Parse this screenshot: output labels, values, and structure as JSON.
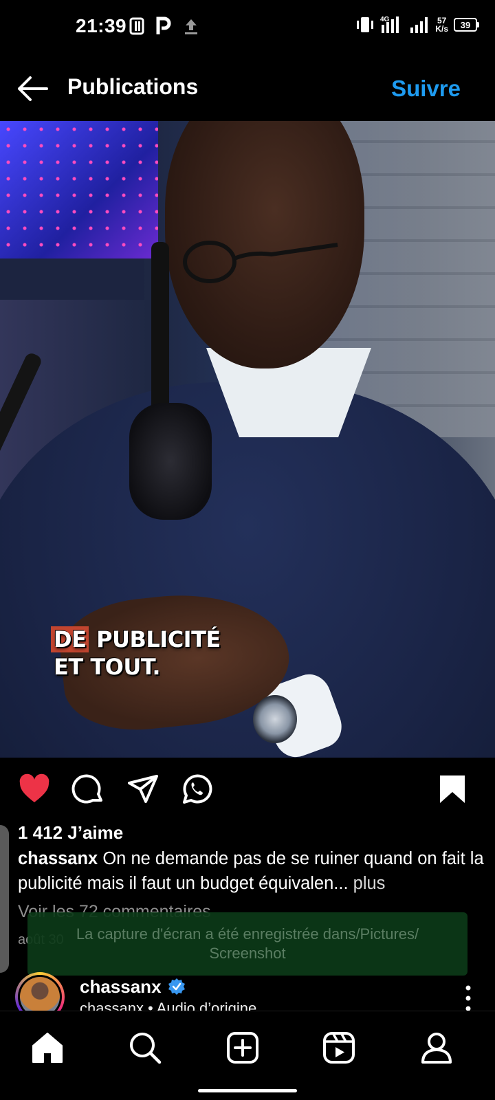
{
  "status_bar": {
    "time": "21:39",
    "net_speed_value": "57",
    "net_speed_unit": "K/s",
    "battery_level": "39",
    "network_type": "4G",
    "icons": [
      "screenshot-icon",
      "parking-app-icon",
      "upload-icon",
      "vibrate-icon",
      "signal-icon",
      "battery-icon"
    ]
  },
  "header": {
    "title": "Publications",
    "follow_label": "Suivre"
  },
  "media": {
    "caption_line1": "DE PUBLICITÉ",
    "caption_line2": "ET TOUT.",
    "caption_highlight": "DE",
    "muted": true
  },
  "actions": {
    "liked": true,
    "saved": true,
    "icons": [
      "heart-icon",
      "comment-icon",
      "share-icon",
      "whatsapp-icon",
      "bookmark-icon"
    ]
  },
  "post": {
    "likes": "1 412 J’aime",
    "author": "chassanx",
    "caption": "On ne demande pas de se ruiner quand on fait la publicité mais il faut un budget équivalen...",
    "more_label": "plus",
    "comments_link": "Voir les 72 commentaires",
    "date": "août 30"
  },
  "toast": {
    "line1": "La capture d'écran a été enregistrée dans/Pictures/",
    "line2": "Screenshot"
  },
  "next_post": {
    "username": "chassanx",
    "verified": true,
    "subtitle": "chassanx • Audio d’origine"
  },
  "bottom_nav": {
    "items": [
      "home-icon",
      "search-icon",
      "create-icon",
      "reels-icon",
      "profile-icon"
    ],
    "active": "home-icon"
  },
  "colors": {
    "accent": "#1e9bf0",
    "like": "#ed3347",
    "verified": "#3897f0",
    "toast_bg": "#0c3a18"
  }
}
